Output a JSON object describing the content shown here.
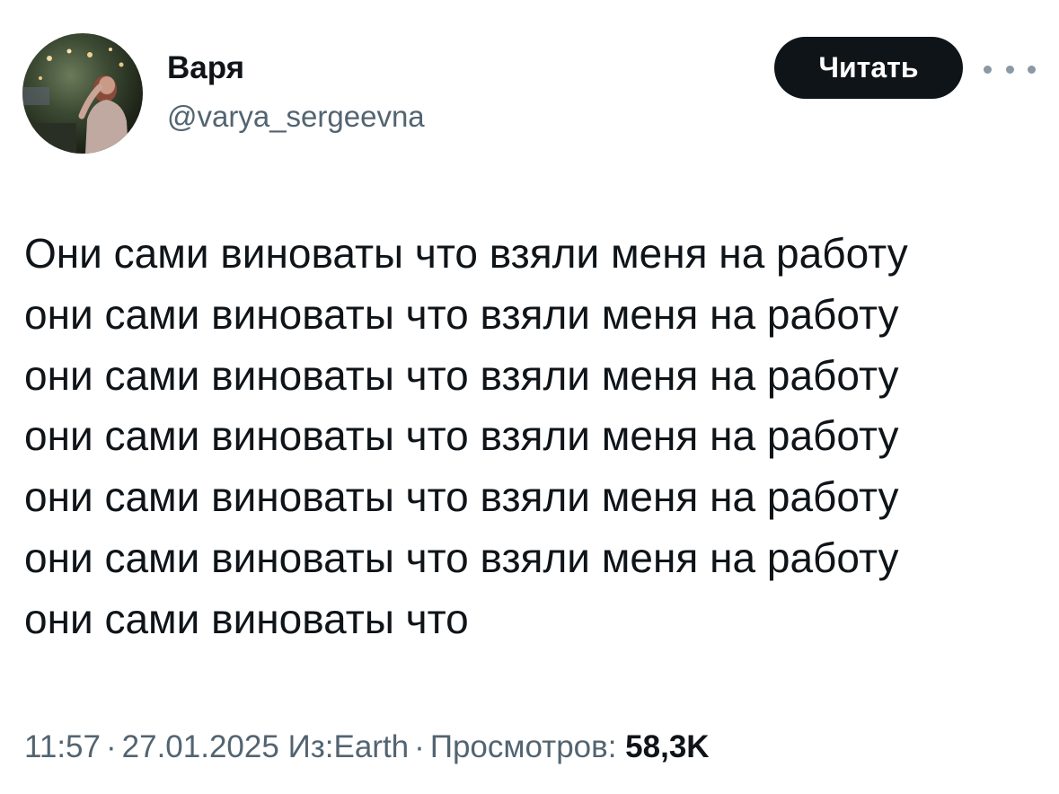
{
  "author": {
    "display_name": "Варя",
    "handle": "@varya_sergeevna"
  },
  "actions": {
    "follow_label": "Читать",
    "more_icon": "more-horizontal-icon"
  },
  "tweet": {
    "lines": [
      "Они сами виноваты что взяли меня на работу",
      "они сами виноваты что взяли меня на работу",
      "они сами виноваты что взяли меня на работу",
      "они сами виноваты что взяли меня на работу",
      "они сами виноваты что взяли меня на работу",
      "они сами виноваты что взяли меня на работу",
      "они сами виноваты что"
    ]
  },
  "meta": {
    "time": "11:57",
    "separator": "·",
    "date": "27.01.2025",
    "source": "Из:Earth",
    "views_label": "Просмотров:",
    "views_count": "58,3K"
  },
  "colors": {
    "text_primary": "#0f1419",
    "text_secondary": "#536471",
    "button_bg": "#0f1419",
    "button_text": "#ffffff"
  }
}
